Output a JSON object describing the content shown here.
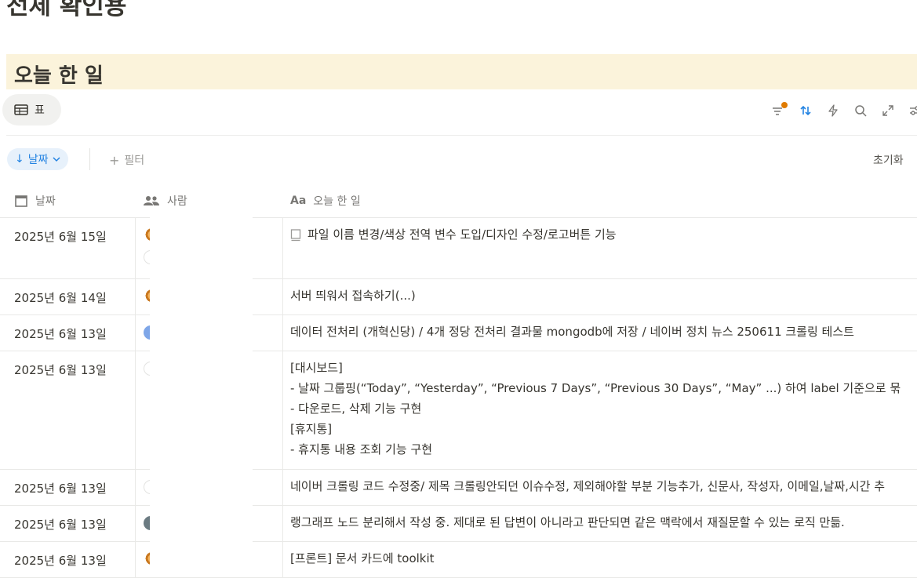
{
  "page": {
    "title": "전체 확인용",
    "callout": "오늘 한 일"
  },
  "view_tab": {
    "label": "표",
    "icon": "table-icon"
  },
  "toolbar": {
    "icons": [
      "filter-icon",
      "sort-icon",
      "automation-icon",
      "search-icon",
      "expand-icon",
      "settings-icon"
    ],
    "filter_active_color": "#e07b00",
    "sort_active_color": "#2383e2"
  },
  "filters": {
    "sort_chip": "날짜",
    "add_filter": "필터",
    "reset": "초기화"
  },
  "columns": {
    "date": "날짜",
    "person": "사람",
    "task_prefix": "Aa",
    "task": "오늘 한 일"
  },
  "rows": [
    {
      "date": "2025년 6월 15일",
      "task": [
        "파일 이름 변경/색상 전역 변수 도입/디자인 수정/로고버튼 기능"
      ]
    },
    {
      "date": "2025년 6월 14일",
      "task": [
        "서버 띄워서 접속하기(...)"
      ]
    },
    {
      "date": "2025년 6월 13일",
      "task": [
        "데이터 전처리 (개혁신당) / 4개 정당 전처리 결과물 mongodb에 저장 / 네이버 정치 뉴스 250611 크롤링 테스트"
      ]
    },
    {
      "date": "2025년 6월 13일",
      "task": [
        "[대시보드]",
        "- 날짜 그룹핑(“Today”, “Yesterday”, “Previous 7 Days”, “Previous 30 Days”, “May” ...) 하여 label 기준으로 묶",
        "- 다운로드, 삭제 기능 구현",
        "[휴지통]",
        "- 휴지통 내용 조회 기능 구현"
      ]
    },
    {
      "date": "2025년 6월 13일",
      "task": [
        "네이버 크롤링 코드 수정중/ 제목 크롤링안되던 이슈수정, 제외해야할 부분 기능추가, 신문사, 작성자, 이메일,날짜,시간 추"
      ]
    },
    {
      "date": "2025년 6월 13일",
      "task": [
        "랭그래프 노드 분리해서 작성 중. 제대로 된 답변이 아니라고 판단되면 같은 맥락에서 재질문할 수 있는 로직 만듦."
      ]
    },
    {
      "date": "2025년 6월 13일",
      "task": [
        "[프론트] 문서 카드에 toolkit"
      ]
    }
  ]
}
